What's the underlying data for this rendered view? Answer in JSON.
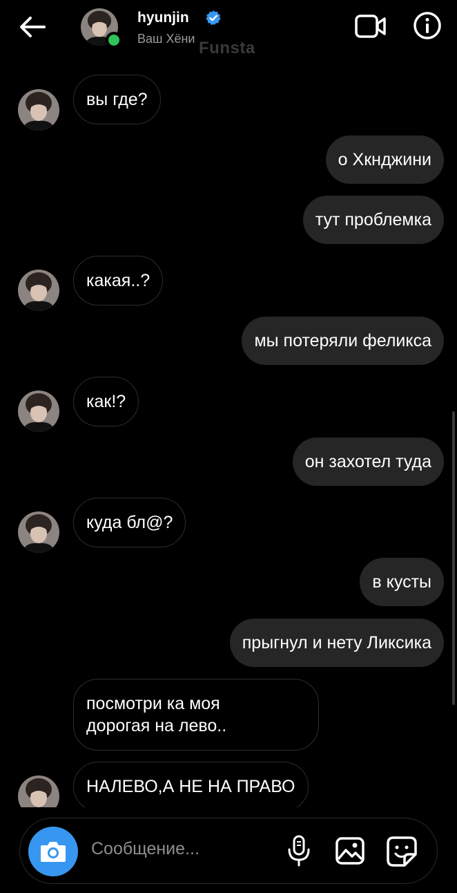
{
  "header": {
    "name": "hyunjin",
    "subtitle": "Ваш Хёни",
    "watermark": "Funsta",
    "icons": [
      "back-arrow-icon",
      "verified-badge-icon",
      "video-call-icon",
      "info-icon"
    ]
  },
  "messages": [
    {
      "side": "in",
      "text": "вы где?",
      "avatar": true
    },
    {
      "side": "out",
      "text": "о Хкнджини"
    },
    {
      "side": "out",
      "text": "тут проблемка"
    },
    {
      "side": "in",
      "text": "какая..?",
      "avatar": true
    },
    {
      "side": "out",
      "text": "мы потеряли феликса"
    },
    {
      "side": "in",
      "text": "как!?",
      "avatar": true
    },
    {
      "side": "out",
      "text": "он захотел туда"
    },
    {
      "side": "in",
      "text": "куда бл@?",
      "avatar": true
    },
    {
      "side": "out",
      "text": "в кусты"
    },
    {
      "side": "out",
      "text": "прыгнул и нету Ликсика"
    },
    {
      "side": "in",
      "text": "посмотри ка моя\nдорогая на лево..",
      "avatar": false
    },
    {
      "side": "in",
      "text": "НАЛЕВО,А НЕ НА ПРАВО",
      "avatar": true
    }
  ],
  "composer": {
    "placeholder": "Сообщение...",
    "icons": [
      "camera-icon",
      "microphone-icon",
      "gallery-icon",
      "sticker-icon"
    ]
  },
  "colors": {
    "background": "#000000",
    "outgoing_bubble": "#262626",
    "incoming_border": "#2e2e2e",
    "accent": "#3797f0",
    "online": "#2fc35a",
    "verified": "#3897f0"
  }
}
